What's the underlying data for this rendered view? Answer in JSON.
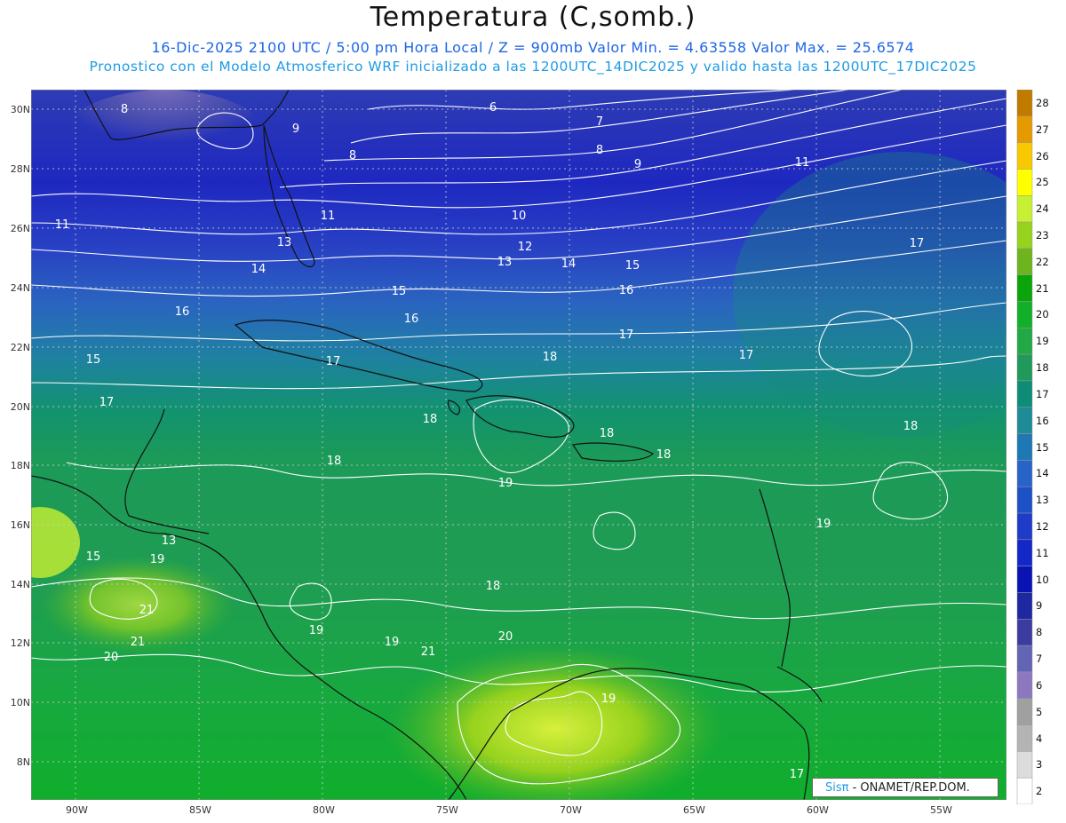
{
  "header": {
    "title": "Temperatura (C,somb.)",
    "subtitle_line1": "16-Dic-2025   2100 UTC / 5:00 pm Hora Local / Z = 900mb      Valor Min. = 4.63558  Valor Max. = 25.6574",
    "subtitle_line2": "Pronostico con el Modelo Atmosferico WRF inicializado a las 1200UTC_14DIC2025 y valido hasta las  1200UTC_17DIC2025"
  },
  "axes": {
    "lat_labels": [
      "30N",
      "28N",
      "26N",
      "24N",
      "22N",
      "20N",
      "18N",
      "16N",
      "14N",
      "12N",
      "10N",
      "8N"
    ],
    "lon_labels": [
      "90W",
      "85W",
      "80W",
      "75W",
      "70W",
      "65W",
      "60W",
      "55W"
    ]
  },
  "legend": {
    "levels": [
      "28",
      "27",
      "26",
      "25",
      "24",
      "23",
      "22",
      "21",
      "20",
      "19",
      "18",
      "17",
      "16",
      "15",
      "14",
      "13",
      "12",
      "11",
      "10",
      "9",
      "8",
      "7",
      "6",
      "5",
      "4",
      "3",
      "2"
    ],
    "colors": [
      "#c07a00",
      "#e49a00",
      "#f8c800",
      "#ffff00",
      "#c8f032",
      "#96d21e",
      "#6eb41e",
      "#0aa50a",
      "#12b028",
      "#23a846",
      "#21995a",
      "#0f8c78",
      "#1e8c96",
      "#1e78b4",
      "#2864c8",
      "#1e50c8",
      "#1e3cc8",
      "#1428c8",
      "#0a14b4",
      "#1e28a0",
      "#3c3ca0",
      "#6464b4",
      "#8c78be",
      "#a0a0a0",
      "#b4b4b4",
      "#dcdcdc",
      "#ffffff"
    ]
  },
  "contour_labels": [
    "6",
    "7",
    "8",
    "9",
    "8",
    "8",
    "9",
    "10",
    "11",
    "11",
    "12",
    "13",
    "13",
    "14",
    "14",
    "15",
    "15",
    "15",
    "16",
    "16",
    "16",
    "17",
    "17",
    "17",
    "17",
    "17",
    "18",
    "18",
    "18",
    "18",
    "18",
    "18",
    "18",
    "19",
    "19",
    "19",
    "19",
    "20",
    "20",
    "21",
    "21",
    "21",
    "19",
    "19",
    "13",
    "11",
    "15",
    "17"
  ],
  "credit": {
    "brand": "Sisπ",
    "text": " - ONAMET/REP.DOM."
  }
}
